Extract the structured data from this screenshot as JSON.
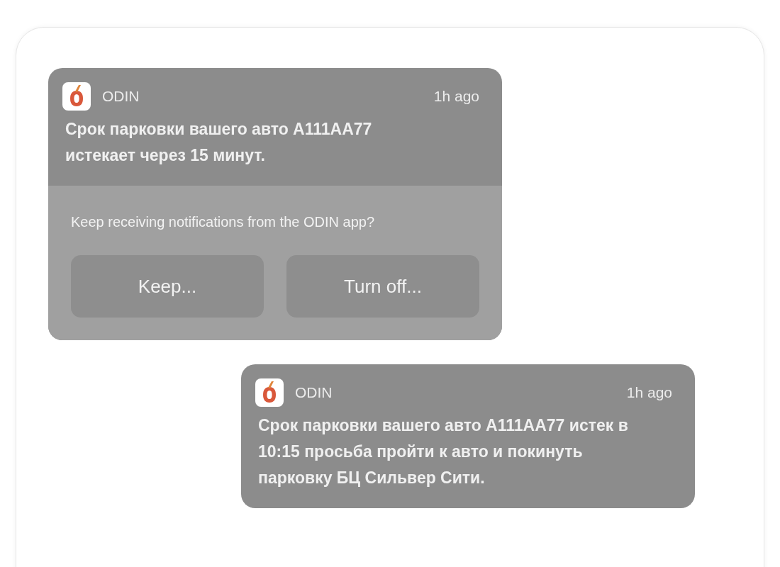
{
  "notifications": [
    {
      "app": "ODIN",
      "time": "1h ago",
      "message": "Срок парковки вашего авто A111AA77 истекает через 15 минут.",
      "prompt": {
        "question": "Keep receiving notifications from the ODIN app?",
        "buttons": [
          "Keep...",
          "Turn off..."
        ]
      }
    },
    {
      "app": "ODIN",
      "time": "1h ago",
      "message": "Срок парковки вашего авто A111AA77 истек в 10:15 просьба пройти к авто и покинуть парковку БЦ Сильвер Сити."
    }
  ]
}
